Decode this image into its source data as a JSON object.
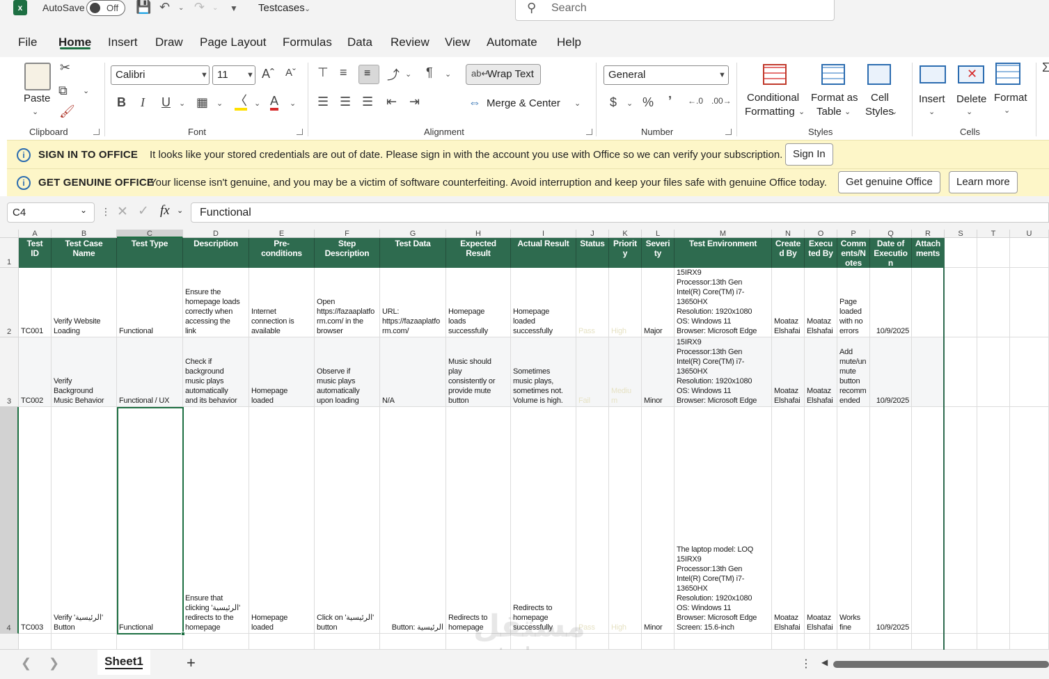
{
  "titlebar": {
    "autosave_label": "AutoSave",
    "autosave_state": "Off",
    "file_name": "Testcases",
    "search_placeholder": "Search"
  },
  "menu": [
    "File",
    "Home",
    "Insert",
    "Draw",
    "Page Layout",
    "Formulas",
    "Data",
    "Review",
    "View",
    "Automate",
    "Help"
  ],
  "ribbon": {
    "clipboard": {
      "paste": "Paste",
      "label": "Clipboard"
    },
    "font": {
      "name": "Calibri",
      "size": "11",
      "label": "Font",
      "bold": "B",
      "italic": "I",
      "underline": "U"
    },
    "alignment": {
      "wrap_text": "Wrap Text",
      "merge_center": "Merge & Center",
      "label": "Alignment"
    },
    "number": {
      "format": "General",
      "label": "Number"
    },
    "styles": {
      "conditional": "Conditional",
      "conditional2": "Formatting",
      "format_as": "Format as",
      "format_as2": "Table",
      "cell": "Cell",
      "cell2": "Styles",
      "label": "Styles"
    },
    "cells": {
      "insert": "Insert",
      "delete": "Delete",
      "format": "Format",
      "label": "Cells"
    }
  },
  "infobar1": {
    "title": "SIGN IN TO OFFICE",
    "message": "It looks like your stored credentials are out of date. Please sign in with the account you use with Office so we can verify your subscription.",
    "button": "Sign In"
  },
  "infobar2": {
    "title": "GET GENUINE OFFICE",
    "message": "Your license isn't genuine, and you may be a victim of software counterfeiting. Avoid interruption and keep your files safe with genuine Office today.",
    "button1": "Get genuine Office",
    "button2": "Learn more"
  },
  "formulabar": {
    "namebox": "C4",
    "fx": "fx",
    "content": "Functional"
  },
  "columns": [
    "A",
    "B",
    "C",
    "D",
    "E",
    "F",
    "G",
    "H",
    "I",
    "J",
    "K",
    "L",
    "M",
    "N",
    "O",
    "P",
    "Q",
    "R",
    "S",
    "T",
    "U"
  ],
  "rows": [
    "1",
    "2",
    "3",
    "4"
  ],
  "header_row": [
    "Test\nID",
    "Test Case\nName",
    "Test Type",
    "Description",
    "Pre-\nconditions",
    "Step\nDescription",
    "Test Data",
    "Expected\nResult",
    "Actual Result",
    "Status",
    "Priorit\ny",
    "Severi\nty",
    "Test Environment",
    "Create\nd By",
    "Execu\nted By",
    "Comm\nents/N\notes",
    "Date of\nExecutio\nn",
    "Attach\nments"
  ],
  "data_rows": [
    [
      "TC001",
      "Verify Website\nLoading",
      "Functional",
      "Ensure the\nhomepage loads\ncorrectly when\naccessing the\nlink",
      "Internet\nconnection is\navailable",
      "Open\nhttps://fazaaplatfo\nrm.com/ in the\nbrowser",
      "URL:\nhttps://fazaaplatfo\nrm.com/",
      "Homepage\nloads\nsuccessfully",
      "Homepage\nloaded\nsuccessfully",
      "Pass",
      "High",
      "Major",
      "15IRX9\nProcessor:13th Gen\nIntel(R) Core(TM) i7-\n13650HX\nResolution: 1920x1080\nOS: Windows 11\nBrowser: Microsoft Edge",
      "Moataz\nElshafai",
      "Moataz\nElshafai",
      "Page\nloaded\nwith no\nerrors",
      "10/9/2025",
      ""
    ],
    [
      "TC002",
      "Verify\nBackground\nMusic Behavior",
      "Functional / UX",
      "Check if\nbackground\nmusic plays\nautomatically\nand its behavior",
      "Homepage\nloaded",
      "Observe if\nmusic plays\nautomatically\nupon loading",
      "N/A",
      "Music should\nplay\nconsistently or\nprovide mute\nbutton",
      "Sometimes\nmusic plays,\nsometimes not.\nVolume is high.",
      "Fail",
      "Mediu\nm",
      "Minor",
      "15IRX9\nProcessor:13th Gen\nIntel(R) Core(TM) i7-\n13650HX\nResolution: 1920x1080\nOS: Windows 11\nBrowser: Microsoft Edge",
      "Moataz\nElshafai",
      "Moataz\nElshafai",
      "Add\nmute/un\nmute\nbutton\nrecomm\nended",
      "10/9/2025",
      ""
    ],
    [
      "TC003",
      "Verify 'الرئيسية'\nButton",
      "Functional",
      "Ensure that\nclicking 'الرئيسية'\nredirects to the\nhomepage",
      "Homepage\nloaded",
      "Click on 'الرئيسية'\nbutton",
      "Button: الرئيسية",
      "Redirects to\nhomepage",
      "Redirects to\nhomepage\nsuccessfully",
      "Pass",
      "High",
      "Minor",
      "The laptop model: LOQ\n15IRX9\nProcessor:13th Gen\nIntel(R) Core(TM) i7-\n13650HX\nResolution: 1920x1080\nOS: Windows 11\nBrowser: Microsoft Edge\nScreen: 15.6-inch",
      "Moataz\nElshafai",
      "Moataz\nElshafai",
      "Works\nfine",
      "10/9/2025",
      ""
    ]
  ],
  "sheet": {
    "name": "Sheet1",
    "add": "+"
  },
  "watermark": {
    "arabic": "مستقل",
    "latin": "mostaql.com"
  },
  "colors": {
    "excel_green": "#1d6f42",
    "header_fill": "#2e6b4f",
    "infobar": "#fdf6c8"
  }
}
